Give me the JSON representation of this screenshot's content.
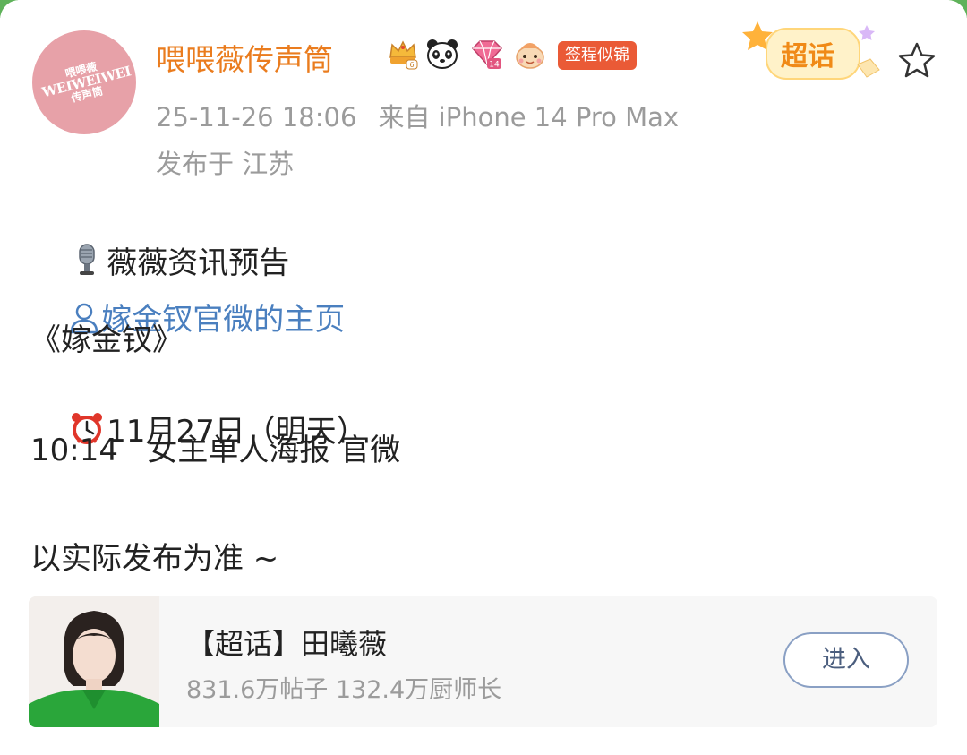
{
  "post": {
    "author_name": "喂喂薇传声筒",
    "avatar_text": {
      "line1": "喂喂薇",
      "line2": "WEIWEIWEI",
      "line3": "传声筒"
    },
    "badges": [
      "crown-lv6-badge",
      "panda-badge",
      "diamond-lv14-badge",
      "mascot-badge"
    ],
    "sign_tag": "签程似锦",
    "chaohua_badge": "超话",
    "timestamp": "25-11-26 18:06",
    "source": "来自 iPhone 14 Pro Max",
    "location": "发布于 江苏",
    "content": {
      "line1": "薇薇资讯预告",
      "mention": "嫁金钗官微的主页",
      "line3": "《嫁金钗》",
      "line4": "11月27日（明天）",
      "line5": "10:14   女主单人海报 官微",
      "line6": "以实际发布为准 ~"
    }
  },
  "topic_card": {
    "title": "【超话】田曦薇",
    "stats": "831.6万帖子 132.4万厨师长",
    "enter_label": "进入"
  },
  "colors": {
    "author": "#ea7c1e",
    "mention": "#4a7fbf",
    "meta": "#9b9b9b",
    "tag_bg": "#ea5a36"
  }
}
